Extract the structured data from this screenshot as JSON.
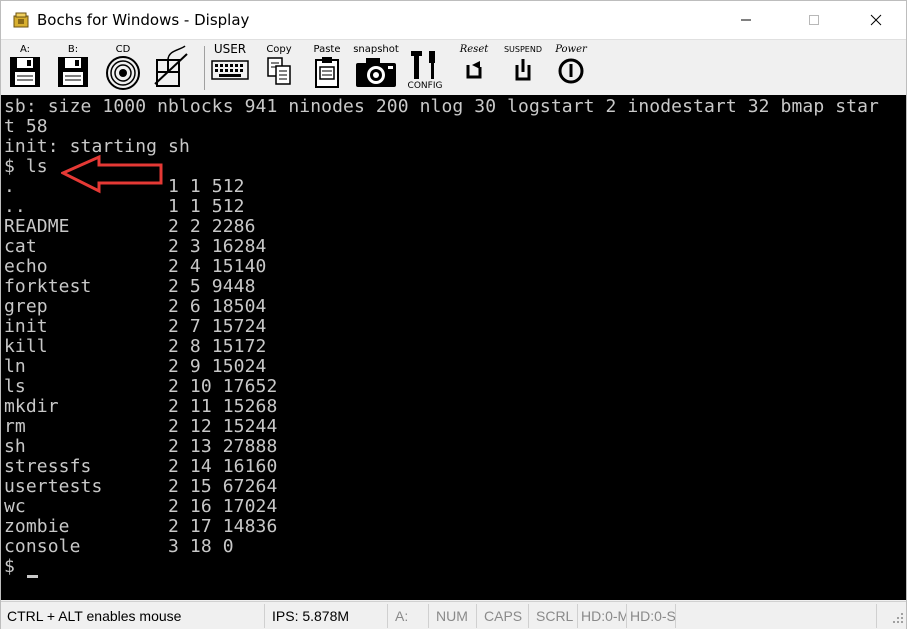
{
  "window": {
    "title": "Bochs for Windows - Display"
  },
  "toolbar": {
    "floppy_a_label": "A:",
    "floppy_b_label": "B:",
    "cdrom_label": "CD",
    "user_label": "USER",
    "copy_label": "Copy",
    "paste_label": "Paste",
    "snapshot_label": "snapshot",
    "config_label": "CONFIG",
    "reset_label": "Reset",
    "suspend_label": "SUSPEND",
    "power_label": "Power"
  },
  "terminal": {
    "lines": [
      "sb: size 1000 nblocks 941 ninodes 200 nlog 30 logstart 2 inodestart 32 bmap star",
      "t 58",
      "init: starting sh",
      "$ ls",
      ".              1 1 512",
      "..             1 1 512",
      "README         2 2 2286",
      "cat            2 3 16284",
      "echo           2 4 15140",
      "forktest       2 5 9448",
      "grep           2 6 18504",
      "init           2 7 15724",
      "kill           2 8 15172",
      "ln             2 9 15024",
      "ls             2 10 17652",
      "mkdir          2 11 15268",
      "rm             2 12 15244",
      "sh             2 13 27888",
      "stressfs       2 14 16160",
      "usertests      2 15 67264",
      "wc             2 16 17024",
      "zombie         2 17 14836",
      "console        3 18 0",
      "$ "
    ],
    "text_color": "#c8c8c8",
    "annotation_color": "#e53935"
  },
  "statusbar": {
    "mouse_hint": "CTRL + ALT enables mouse",
    "ips": "IPS: 5.878M",
    "drive_a": "A:",
    "num": "NUM",
    "caps": "CAPS",
    "scrl": "SCRL",
    "hd0_m": "HD:0-M",
    "hd0_s": "HD:0-S"
  }
}
